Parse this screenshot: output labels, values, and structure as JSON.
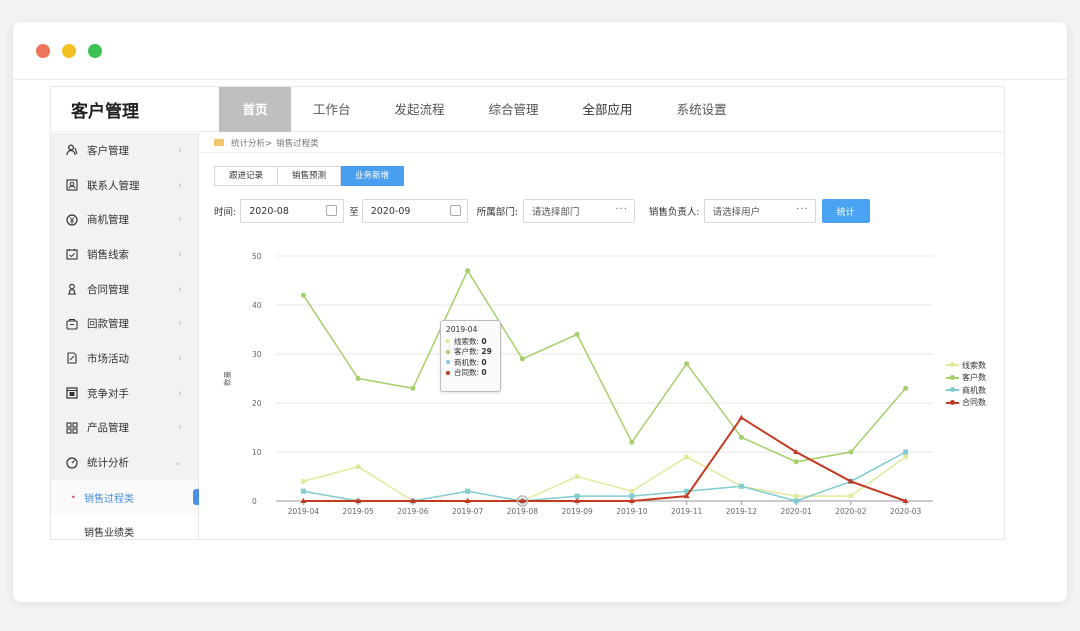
{
  "window": {
    "controls": [
      "close",
      "minimize",
      "maximize"
    ]
  },
  "app": {
    "brand": "客户管理"
  },
  "topnav": [
    "首页",
    "工作台",
    "发起流程",
    "综合管理",
    "全部应用",
    "系统设置"
  ],
  "sidebar": {
    "items": [
      {
        "label": "客户管理",
        "icon": "user-icon"
      },
      {
        "label": "联系人管理",
        "icon": "contact-icon"
      },
      {
        "label": "商机管理",
        "icon": "opportunity-icon"
      },
      {
        "label": "销售线索",
        "icon": "leads-icon"
      },
      {
        "label": "合同管理",
        "icon": "contract-icon"
      },
      {
        "label": "回款管理",
        "icon": "payment-icon"
      },
      {
        "label": "市场活动",
        "icon": "campaign-icon"
      },
      {
        "label": "竞争对手",
        "icon": "competitor-icon"
      },
      {
        "label": "产品管理",
        "icon": "product-icon"
      },
      {
        "label": "统计分析",
        "icon": "stats-icon"
      }
    ],
    "subitems": [
      {
        "label": "销售过程类"
      },
      {
        "label": "销售业绩类"
      }
    ]
  },
  "breadcrumb": {
    "parent": "统计分析>",
    "current": "销售过程类"
  },
  "tabs": [
    "跟进记录",
    "销售预测",
    "业务新增"
  ],
  "filters": {
    "time_label": "时间:",
    "start": "2020-08",
    "to_label": "至",
    "end": "2020-09",
    "dept_label": "所属部门:",
    "dept_placeholder": "请选择部门",
    "owner_label": "销售负责人:",
    "owner_placeholder": "请选择用户",
    "submit": "统计"
  },
  "tooltip": {
    "title": "2019-04",
    "rows": [
      {
        "label": "线索数",
        "value": "0",
        "color": "#e2e89a"
      },
      {
        "label": "客户数",
        "value": "29",
        "color": "#a4cf6a"
      },
      {
        "label": "商机数",
        "value": "0",
        "color": "#7fcbd0"
      },
      {
        "label": "合同数",
        "value": "0",
        "color": "#c23a22"
      }
    ]
  },
  "chart_data": {
    "type": "line",
    "ylabel": "数量",
    "ylim": [
      0,
      50
    ],
    "yticks": [
      0,
      10,
      20,
      30,
      40,
      50
    ],
    "grid": true,
    "legend_position": "right",
    "categories": [
      "2019-04",
      "2019-05",
      "2019-06",
      "2019-07",
      "2019-08",
      "2019-09",
      "2019-10",
      "2019-11",
      "2019-12",
      "2020-01",
      "2020-02",
      "2020-03"
    ],
    "series": [
      {
        "name": "线索数",
        "color": "#e2e89a",
        "values": [
          4,
          7,
          0,
          0,
          0,
          5,
          2,
          9,
          3,
          1,
          1,
          9
        ]
      },
      {
        "name": "客户数",
        "color": "#a4cf6a",
        "values": [
          42,
          25,
          23,
          47,
          29,
          34,
          12,
          28,
          13,
          8,
          10,
          23
        ]
      },
      {
        "name": "商机数",
        "color": "#7fcbd0",
        "values": [
          2,
          0,
          0,
          2,
          0,
          1,
          1,
          2,
          3,
          0,
          4,
          10
        ]
      },
      {
        "name": "合同数",
        "color": "#c23a22",
        "values": [
          0,
          0,
          0,
          0,
          0,
          0,
          0,
          1,
          17,
          10,
          4,
          0
        ]
      }
    ]
  }
}
